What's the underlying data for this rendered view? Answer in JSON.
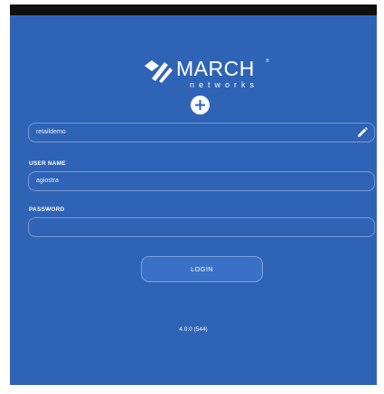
{
  "brand": {
    "name": "MARCH",
    "subtitle": "networks",
    "trademark": "®"
  },
  "server_field": {
    "value": "retaildemo"
  },
  "username": {
    "label": "USER NAME",
    "value": "agiostra"
  },
  "password": {
    "label": "PASSWORD",
    "value": ""
  },
  "login_button": {
    "label": "LOGIN"
  },
  "version": "4.0.0 (544)",
  "colors": {
    "background": "#2f63b6",
    "button": "#3a70c6",
    "topbar": "#101010"
  },
  "icons": {
    "add": "plus-circle-icon",
    "edit": "pencil-icon",
    "logo": "march-networks-logo"
  }
}
